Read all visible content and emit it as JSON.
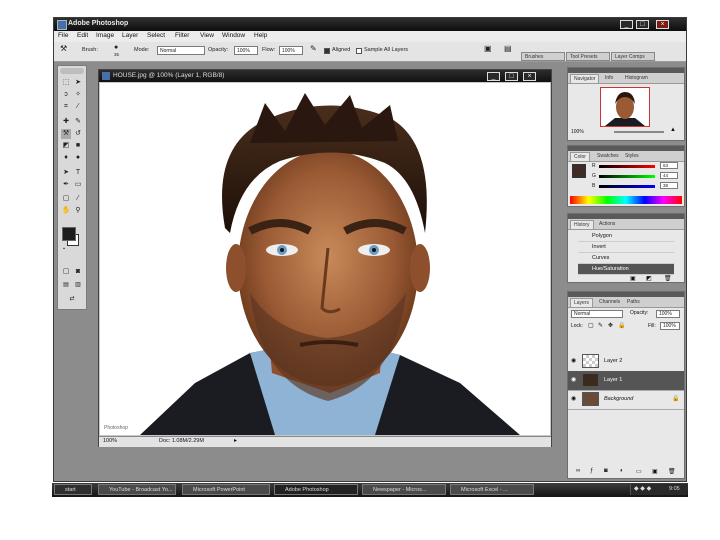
{
  "window": {
    "title": "Adobe Photoshop",
    "min": "_",
    "max": "□",
    "close": "×"
  },
  "menu": [
    "File",
    "Edit",
    "Image",
    "Layer",
    "Select",
    "Filter",
    "View",
    "Window",
    "Help"
  ],
  "options": {
    "brush_label": "Brush:",
    "brush_size": "35",
    "mode_label": "Mode:",
    "mode_value": "Normal",
    "opacity_label": "Opacity:",
    "opacity_value": "100%",
    "flow_label": "Flow:",
    "flow_value": "100%",
    "aligned_label": "Aligned",
    "sample_label": "Sample All Layers",
    "tabs": [
      "Brushes",
      "Tool Presets",
      "Layer Comps"
    ]
  },
  "document": {
    "title": "HOUSE.jpg @ 100% (Layer 1, RGB/8)",
    "zoom": "100%",
    "doc_size": "Doc: 1.08M/2.29M",
    "watermark": "Photoshop"
  },
  "navigator": {
    "tabs": [
      "Navigator",
      "Info",
      "Histogram"
    ],
    "zoom": "100%"
  },
  "color": {
    "tabs": [
      "Color",
      "Swatches",
      "Styles"
    ],
    "channels": [
      {
        "label": "R",
        "value": "63"
      },
      {
        "label": "G",
        "value": "44"
      },
      {
        "label": "B",
        "value": "38"
      }
    ]
  },
  "history": {
    "tabs": [
      "History",
      "Actions"
    ],
    "items": [
      "Polygon",
      "Invert",
      "Curves",
      "Hue/Saturation"
    ]
  },
  "layers": {
    "tabs": [
      "Layers",
      "Channels",
      "Paths"
    ],
    "blend_mode": "Normal",
    "opacity_label": "Opacity:",
    "opacity_value": "100%",
    "lock_label": "Lock:",
    "fill_label": "Fill:",
    "fill_value": "100%",
    "items": [
      {
        "name": "Layer 2",
        "selected": false
      },
      {
        "name": "Layer 1",
        "selected": true
      },
      {
        "name": "Background",
        "selected": false
      }
    ]
  },
  "taskbar": {
    "start": "start",
    "items": [
      "YouTube - Broadcast Yo...",
      "Microsoft PowerPoint",
      "Adobe Photoshop",
      "Newspaper - Micros...",
      "Microsoft Excel - ..."
    ],
    "clock": "9:05"
  },
  "colors": {
    "title_bar": "#1a1a1a",
    "panel_bg": "#e8e8e8",
    "workspace": "#8c8c8c",
    "selected_layer": "#555555"
  }
}
